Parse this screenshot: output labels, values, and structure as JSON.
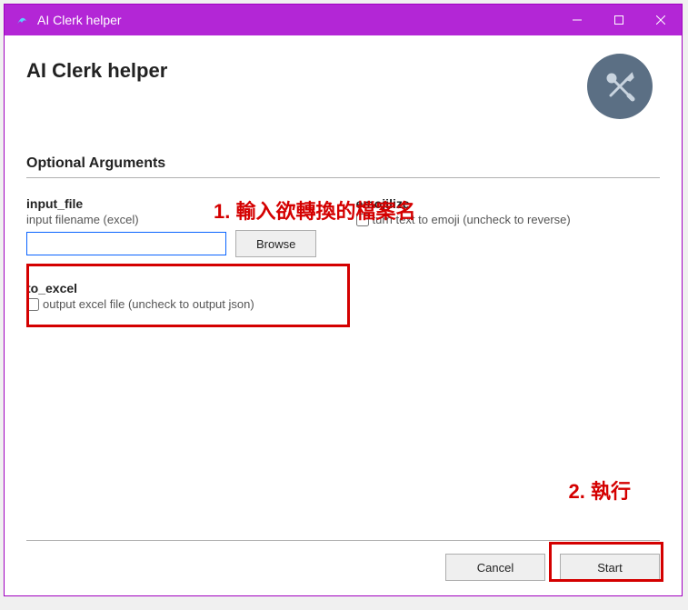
{
  "titlebar": {
    "title": "AI Clerk helper"
  },
  "header": {
    "app_title": "AI Clerk helper"
  },
  "section": {
    "title": "Optional Arguments"
  },
  "input_file": {
    "label": "input_file",
    "desc": "input filename (excel)",
    "value": "",
    "browse_label": "Browse"
  },
  "emojilize": {
    "label": "emojilize",
    "checkbox_label": "turn text to emoji (uncheck to reverse)"
  },
  "to_excel": {
    "label": "to_excel",
    "checkbox_label": "output excel file (uncheck to output json)"
  },
  "footer": {
    "cancel_label": "Cancel",
    "start_label": "Start"
  },
  "annotations": {
    "a1": "1. 輸入欲轉換的檔案名",
    "a2": "2. 執行"
  }
}
